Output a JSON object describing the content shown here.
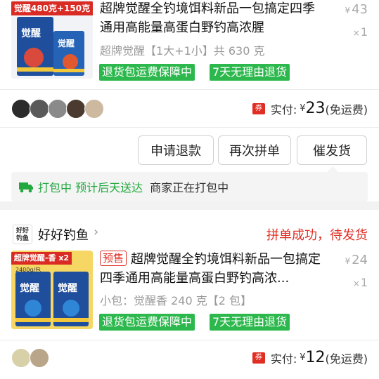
{
  "colors": {
    "accent": "#e02e24",
    "green": "#2db84d",
    "status_green": "#22a83e"
  },
  "order1": {
    "thumb_banner": "觉醒480克+150克",
    "title": "超牌觉醒全钓境饵料新品一包搞定四季通用高能量高蛋白野钓高浓腥",
    "variant": "超牌觉醒【1大+1小】共 630 克",
    "price": "43",
    "qty": "1",
    "tags": [
      "退货包运费保障中",
      "7天无理由退货"
    ],
    "paid_label": "实付:",
    "paid_amount": "23",
    "paid_shipping": "(免运费)",
    "buttons": [
      "申请退款",
      "再次拼单",
      "催发货"
    ],
    "status_icon": "truck-icon",
    "status_green": "打包中 预计后天送达",
    "status_black": "商家正在打包中"
  },
  "order2": {
    "shop_logo": "好好钓鱼",
    "shop_name": "好好钓鱼",
    "order_status": "拼单成功，待发货",
    "thumb_banner": "超牌觉醒-香 x2",
    "thumb_weight": "2400g/包",
    "presale": "预售",
    "title": "超牌觉醒全钓境饵料新品一包搞定四季通用高能量高蛋白野钓高浓...",
    "variant": "小包：觉醒香 240 克【2 包】",
    "price": "24",
    "qty": "1",
    "tags": [
      "退货包运费保障中",
      "7天无理由退货"
    ],
    "paid_label": "实付:",
    "paid_amount": "12",
    "paid_shipping": "(免运费)"
  },
  "coupon_label": "券",
  "currency": "¥",
  "qty_prefix": "×",
  "chevron": "›"
}
